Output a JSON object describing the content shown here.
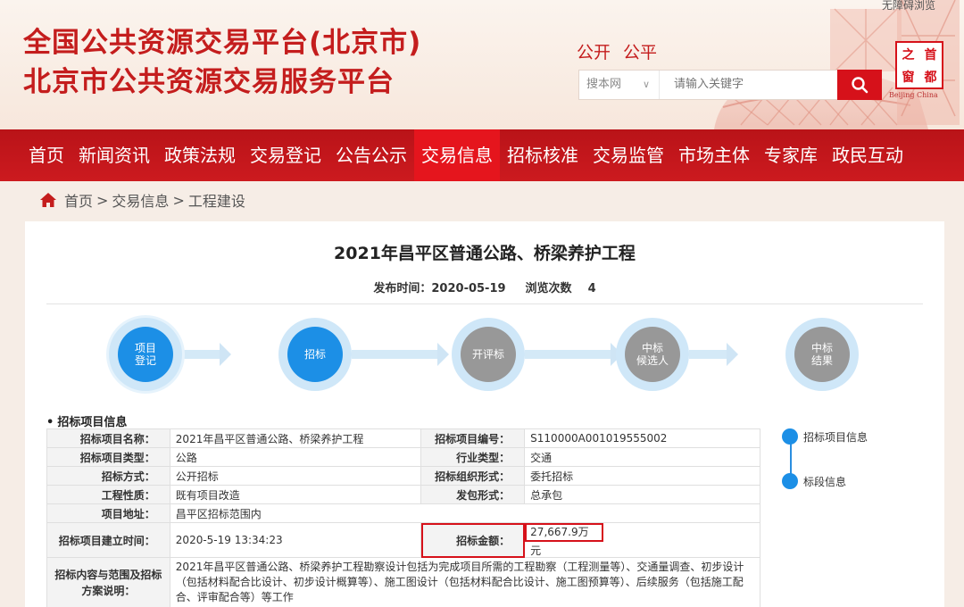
{
  "header": {
    "title_line1": "全国公共资源交易平台(北京市)",
    "title_line2": "北京市公共资源交易服务平台",
    "slogan": [
      "公开",
      "公平"
    ],
    "top_link": "无障碍浏览",
    "search": {
      "scope": "搜本网",
      "placeholder": "请输入关键字"
    },
    "logo": {
      "chars": [
        "之",
        "首",
        "窗",
        "都"
      ],
      "subtitle": "Beijing China"
    }
  },
  "nav": {
    "items": [
      "首页",
      "新闻资讯",
      "政策法规",
      "交易登记",
      "公告公示",
      "交易信息",
      "招标核准",
      "交易监管",
      "市场主体",
      "专家库",
      "政民互动"
    ],
    "active_index": 5
  },
  "breadcrumb": {
    "home": "首页",
    "sep1": ">",
    "level1": "交易信息",
    "sep2": ">",
    "level2": "工程建设"
  },
  "project": {
    "title": "2021年昌平区普通公路、桥梁养护工程",
    "publish_label": "发布时间：",
    "publish_date": "2020-05-19",
    "views_label": "浏览次数",
    "views": "4"
  },
  "steps": [
    {
      "label": "项目\n登记",
      "state": "done"
    },
    {
      "label": "招标",
      "state": "done"
    },
    {
      "label": "开评标",
      "state": "todo"
    },
    {
      "label": "中标\n候选人",
      "state": "todo"
    },
    {
      "label": "中标\n结果",
      "state": "todo"
    }
  ],
  "section": {
    "bullet": "•",
    "title": "招标项目信息"
  },
  "table": {
    "r1": {
      "l1": "招标项目名称：",
      "v1": "2021年昌平区普通公路、桥梁养护工程",
      "l2": "招标项目编号：",
      "v2": "S110000A001019555002"
    },
    "r2": {
      "l1": "招标项目类型：",
      "v1": "公路",
      "l2": "行业类型：",
      "v2": "交通"
    },
    "r3": {
      "l1": "招标方式：",
      "v1": "公开招标",
      "l2": "招标组织形式：",
      "v2": "委托招标"
    },
    "r4": {
      "l1": "工程性质：",
      "v1": "既有项目改造",
      "l2": "发包形式：",
      "v2": "总承包"
    },
    "r5": {
      "l1": "项目地址：",
      "v1": "昌平区招标范围内"
    },
    "r6": {
      "l1": "招标项目建立时间：",
      "v1": "2020-5-19 13:34:23",
      "l2": "招标金额：",
      "v2": "27,667.9万元"
    },
    "r7": {
      "l1": "招标内容与范围及招标方案说明：",
      "v1": "2021年昌平区普通公路、桥梁养护工程勘察设计包括为完成项目所需的工程勘察（工程测量等）、交通量调查、初步设计（包括材料配合比设计、初步设计概算等）、施工图设计（包括材料配合比设计、施工图预算等）、后续服务（包括施工配合、评审配合等）等工作"
    }
  },
  "side_nav": [
    "招标项目信息",
    "标段信息"
  ],
  "colors": {
    "brand_red": "#d6111a",
    "nav_red": "#c4161c",
    "step_blue": "#1c8fe6",
    "step_gray": "#989898"
  }
}
